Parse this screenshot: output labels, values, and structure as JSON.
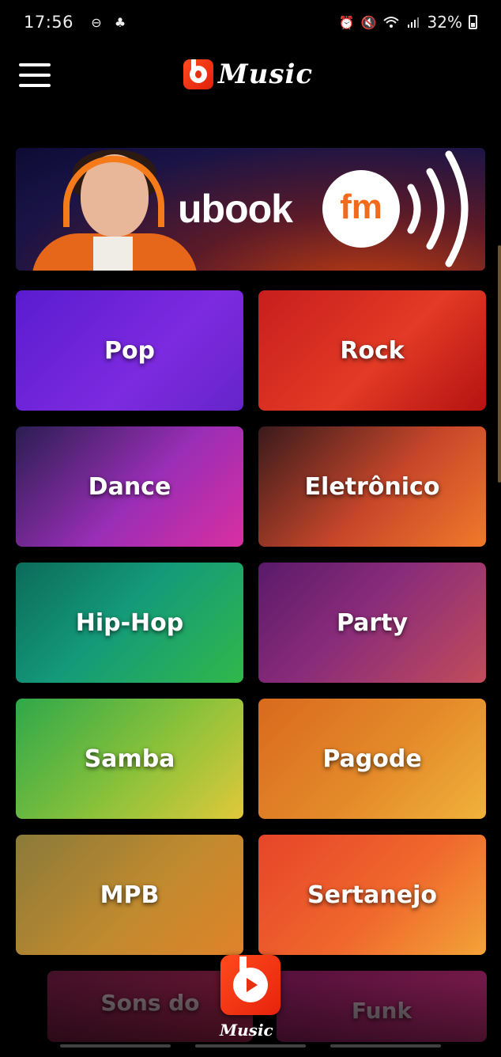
{
  "status_bar": {
    "time": "17:56",
    "battery": "32%",
    "left_icons": [
      "dnd-icon",
      "notification-icon"
    ],
    "right_icons": [
      "alarm-icon",
      "mute-icon",
      "wifi-icon",
      "signal-icon",
      "battery-icon"
    ]
  },
  "app_bar": {
    "logo_text": "Music",
    "menu_icon": "hamburger-menu-icon"
  },
  "banner": {
    "brand": "ubook",
    "badge": "fm"
  },
  "genres": [
    {
      "label": "Pop",
      "color": "#6a23d6"
    },
    {
      "label": "Rock",
      "color": "#d52a20"
    },
    {
      "label": "Dance",
      "color": "#9a2eb6"
    },
    {
      "label": "Eletrônico",
      "color": "#c8472a"
    },
    {
      "label": "Hip-Hop",
      "color": "#149a7a"
    },
    {
      "label": "Party",
      "color": "#8a2c7a"
    },
    {
      "label": "Samba",
      "color": "#8ac23a"
    },
    {
      "label": "Pagode",
      "color": "#e48a2a"
    },
    {
      "label": "MPB",
      "color": "#c08a2e"
    },
    {
      "label": "Sertanejo",
      "color": "#f0672c"
    },
    {
      "label": "Sons do",
      "color": "#c02a5a"
    },
    {
      "label": "Funk",
      "color": "#e0348a"
    }
  ],
  "bottom_nav": {
    "center_label": "Music",
    "accent": "#e6300f"
  }
}
